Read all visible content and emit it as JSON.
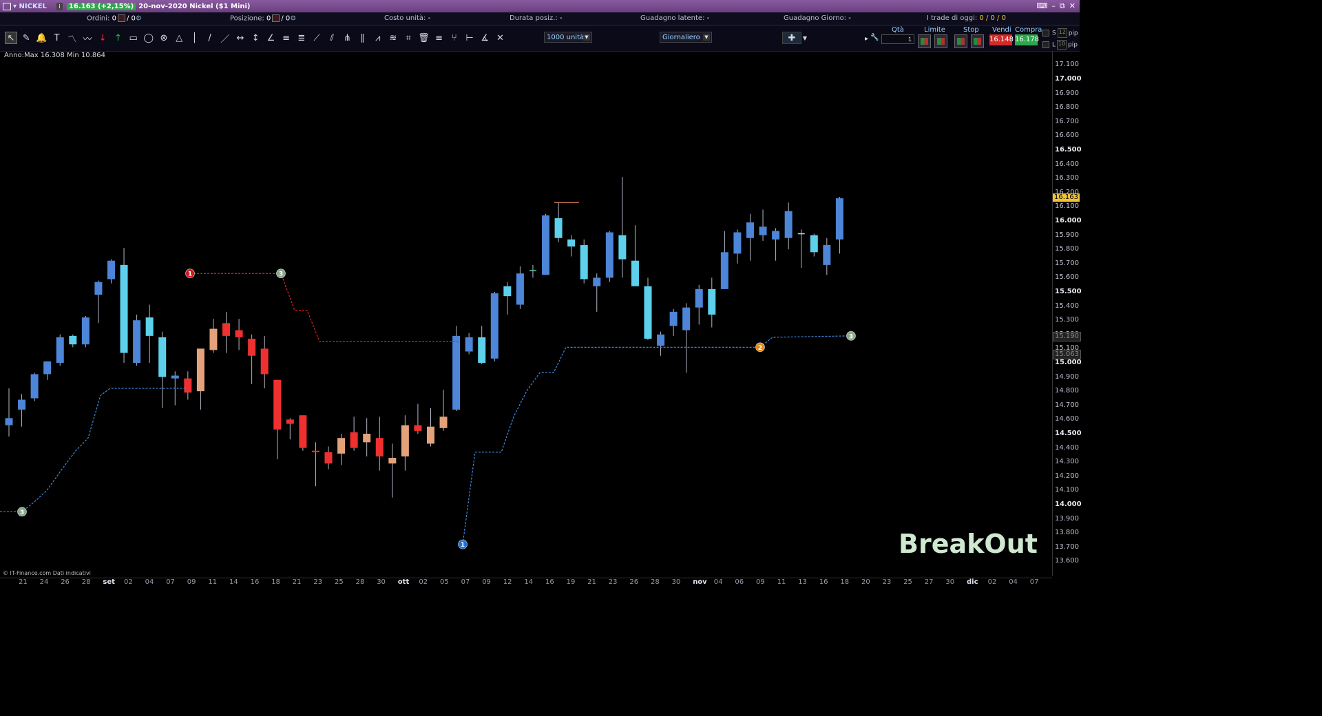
{
  "window": {
    "symbol": "NICKEL",
    "quote_badge": "16.163 (+2,15%)",
    "description": "20-nov-2020 Nickel ($1 Mini)"
  },
  "infobar": {
    "orders_label": "Ordini:",
    "orders_value": "0",
    "orders_sep": "/ 0",
    "position_label": "Posizione:",
    "position_value": "0",
    "position_sep": "/ 0",
    "unit_cost_label": "Costo unità:",
    "unit_cost_value": "-",
    "duration_label": "Durata posiz.:",
    "duration_value": "-",
    "latent_gain_label": "Guadagno latente:",
    "latent_gain_value": "-",
    "day_gain_label": "Guadagno Giorno:",
    "day_gain_value": "-",
    "trades_label": "I trade di oggi:",
    "trades_value": "0 / 0 / 0"
  },
  "toolbar": {
    "units_select": "1000 unità",
    "period_select": "Giornaliero",
    "tools": [
      "pointer-tool",
      "pencil-tool",
      "alert-bell-tool",
      "text-tool",
      "indicator-line-tool",
      "wave-tool",
      "sell-arrow-tool",
      "buy-arrow-tool",
      "rectangle-tool",
      "ellipse-tool",
      "circle-tool",
      "triangle-tool",
      "vertical-line-tool",
      "trend-line-tool",
      "ray-tool",
      "horizontal-segment-tool",
      "vertical-segment-tool",
      "angle-tool",
      "fibonacci-tool",
      "fibonacci-fan-tool",
      "gann-fan-tool",
      "speed-lines-tool",
      "andrews-tool",
      "parallel-channel-tool",
      "regression-tool",
      "raff-channel-tool",
      "gann-grid-tool",
      "trash-tool",
      "equidistant-channel-tool",
      "pitchfork-tool",
      "measure-tool",
      "gann-angle-tool",
      "cross-lines-tool"
    ]
  },
  "trade_panel": {
    "qty_label": "Qtà",
    "qty_value": "1",
    "limit_label": "Limite",
    "stop_label": "Stop",
    "sell_label": "Vendi",
    "sell_price": "16.148",
    "buy_label": "Compra",
    "buy_price": "16.178",
    "s_label": "S",
    "s_value": "12",
    "l_label": "L",
    "l_value": "10",
    "pip_label": "pip"
  },
  "range_label": "Anno:Max 16.308 Min 10.864",
  "copyright": "© IT-Finance.com Dati indicativi",
  "brand_text": "BreakOut",
  "colors": {
    "bull_dark": "#4d85d8",
    "bull_light": "#5dd0ec",
    "bear_red": "#ee3030",
    "bear_tan": "#e3a27a",
    "stop_blue": "#3d8be0",
    "stop_red": "#e02020",
    "current_price_bg": "#f2c230"
  },
  "chart_data": {
    "type": "candlestick",
    "y_ticks": [
      "17.100",
      "17.000",
      "16.900",
      "16.800",
      "16.700",
      "16.600",
      "16.500",
      "16.400",
      "16.300",
      "16.200",
      "16.100",
      "16.000",
      "15.900",
      "15.800",
      "15.700",
      "15.600",
      "15.500",
      "15.400",
      "15.300",
      "15.200",
      "15.100",
      "15.000",
      "14.900",
      "14.800",
      "14.700",
      "14.600",
      "14.500",
      "14.400",
      "14.300",
      "14.200",
      "14.100",
      "14.000",
      "13.900",
      "13.800",
      "13.700",
      "13.600"
    ],
    "y_major": [
      "17.000",
      "16.500",
      "16.000",
      "15.500",
      "15.000",
      "14.500",
      "14.000"
    ],
    "current_price": "16.163",
    "price_markers": [
      {
        "value": "15.190",
        "style": "line"
      },
      {
        "value": "15.063",
        "style": "line"
      }
    ],
    "x_labels": [
      "21",
      "24",
      "26",
      "28",
      "set",
      "02",
      "04",
      "07",
      "09",
      "11",
      "14",
      "16",
      "18",
      "21",
      "23",
      "25",
      "28",
      "30",
      "ott",
      "02",
      "05",
      "07",
      "09",
      "12",
      "14",
      "16",
      "19",
      "21",
      "23",
      "26",
      "28",
      "30",
      "nov",
      "04",
      "06",
      "09",
      "11",
      "13",
      "16",
      "18",
      "20",
      "23",
      "25",
      "27",
      "30",
      "dic",
      "02",
      "04",
      "07"
    ],
    "candles": [
      {
        "o": 14.56,
        "h": 14.82,
        "l": 14.48,
        "c": 14.61,
        "k": "bd"
      },
      {
        "o": 14.67,
        "h": 14.78,
        "l": 14.55,
        "c": 14.74,
        "k": "bd"
      },
      {
        "o": 14.75,
        "h": 14.93,
        "l": 14.73,
        "c": 14.92,
        "k": "bd"
      },
      {
        "o": 14.92,
        "h": 15.0,
        "l": 14.88,
        "c": 15.01,
        "k": "bd"
      },
      {
        "o": 15.0,
        "h": 15.2,
        "l": 14.98,
        "c": 15.18,
        "k": "bd"
      },
      {
        "o": 15.13,
        "h": 15.2,
        "l": 15.11,
        "c": 15.19,
        "k": "bl"
      },
      {
        "o": 15.13,
        "h": 15.33,
        "l": 15.11,
        "c": 15.32,
        "k": "bd"
      },
      {
        "o": 15.48,
        "h": 15.58,
        "l": 15.28,
        "c": 15.57,
        "k": "bd"
      },
      {
        "o": 15.59,
        "h": 15.73,
        "l": 15.56,
        "c": 15.72,
        "k": "bd"
      },
      {
        "o": 15.69,
        "h": 15.81,
        "l": 15.0,
        "c": 15.07,
        "k": "bl"
      },
      {
        "o": 15.0,
        "h": 15.34,
        "l": 14.98,
        "c": 15.3,
        "k": "bd"
      },
      {
        "o": 15.19,
        "h": 15.41,
        "l": 15.0,
        "c": 15.32,
        "k": "bl"
      },
      {
        "o": 15.18,
        "h": 15.22,
        "l": 14.68,
        "c": 14.9,
        "k": "bl"
      },
      {
        "o": 14.89,
        "h": 14.94,
        "l": 14.7,
        "c": 14.91,
        "k": "bd"
      },
      {
        "o": 14.89,
        "h": 14.94,
        "l": 14.74,
        "c": 14.79,
        "k": "rr"
      },
      {
        "o": 14.8,
        "h": 15.0,
        "l": 14.67,
        "c": 15.1,
        "k": "rt"
      },
      {
        "o": 15.09,
        "h": 15.31,
        "l": 15.07,
        "c": 15.24,
        "k": "rt"
      },
      {
        "o": 15.28,
        "h": 15.36,
        "l": 15.07,
        "c": 15.19,
        "k": "rr"
      },
      {
        "o": 15.23,
        "h": 15.31,
        "l": 15.09,
        "c": 15.18,
        "k": "rr"
      },
      {
        "o": 15.17,
        "h": 15.2,
        "l": 14.85,
        "c": 15.05,
        "k": "rr"
      },
      {
        "o": 15.1,
        "h": 15.19,
        "l": 14.82,
        "c": 14.92,
        "k": "rr"
      },
      {
        "o": 14.88,
        "h": 14.88,
        "l": 14.32,
        "c": 14.53,
        "k": "rr"
      },
      {
        "o": 14.6,
        "h": 14.61,
        "l": 14.46,
        "c": 14.57,
        "k": "rr"
      },
      {
        "o": 14.63,
        "h": 14.63,
        "l": 14.38,
        "c": 14.4,
        "k": "rr"
      },
      {
        "o": 14.37,
        "h": 14.44,
        "l": 14.13,
        "c": 14.38,
        "k": "rr"
      },
      {
        "o": 14.37,
        "h": 14.41,
        "l": 14.25,
        "c": 14.29,
        "k": "rr"
      },
      {
        "o": 14.36,
        "h": 14.5,
        "l": 14.28,
        "c": 14.47,
        "k": "rt"
      },
      {
        "o": 14.51,
        "h": 14.62,
        "l": 14.38,
        "c": 14.4,
        "k": "rr"
      },
      {
        "o": 14.44,
        "h": 14.61,
        "l": 14.34,
        "c": 14.5,
        "k": "rt"
      },
      {
        "o": 14.47,
        "h": 14.62,
        "l": 14.24,
        "c": 14.34,
        "k": "rr"
      },
      {
        "o": 14.29,
        "h": 14.43,
        "l": 14.05,
        "c": 14.33,
        "k": "rt"
      },
      {
        "o": 14.34,
        "h": 14.63,
        "l": 14.24,
        "c": 14.56,
        "k": "rt"
      },
      {
        "o": 14.56,
        "h": 14.71,
        "l": 14.5,
        "c": 14.52,
        "k": "rr"
      },
      {
        "o": 14.43,
        "h": 14.68,
        "l": 14.41,
        "c": 14.55,
        "k": "rt"
      },
      {
        "o": 14.54,
        "h": 14.81,
        "l": 14.52,
        "c": 14.62,
        "k": "rt"
      },
      {
        "o": 14.67,
        "h": 15.26,
        "l": 14.66,
        "c": 15.19,
        "k": "bd"
      },
      {
        "o": 15.08,
        "h": 15.21,
        "l": 15.06,
        "c": 15.18,
        "k": "bd"
      },
      {
        "o": 15.0,
        "h": 15.26,
        "l": 14.99,
        "c": 15.18,
        "k": "bl"
      },
      {
        "o": 15.03,
        "h": 15.5,
        "l": 15.01,
        "c": 15.49,
        "k": "bd"
      },
      {
        "o": 15.47,
        "h": 15.57,
        "l": 15.34,
        "c": 15.54,
        "k": "bl"
      },
      {
        "o": 15.41,
        "h": 15.68,
        "l": 15.38,
        "c": 15.63,
        "k": "bd"
      },
      {
        "o": 15.64,
        "h": 15.69,
        "l": 15.6,
        "c": 15.65,
        "k": "cross"
      },
      {
        "o": 15.62,
        "h": 16.05,
        "l": 15.62,
        "c": 16.04,
        "k": "bd"
      },
      {
        "o": 16.02,
        "h": 16.13,
        "l": 15.85,
        "c": 15.88,
        "k": "bl"
      },
      {
        "o": 15.87,
        "h": 15.9,
        "l": 15.75,
        "c": 15.82,
        "k": "bl"
      },
      {
        "o": 15.83,
        "h": 15.87,
        "l": 15.56,
        "c": 15.59,
        "k": "bl"
      },
      {
        "o": 15.54,
        "h": 15.63,
        "l": 15.36,
        "c": 15.6,
        "k": "bd"
      },
      {
        "o": 15.6,
        "h": 15.93,
        "l": 15.57,
        "c": 15.92,
        "k": "bd"
      },
      {
        "o": 15.9,
        "h": 16.31,
        "l": 15.6,
        "c": 15.73,
        "k": "bl"
      },
      {
        "o": 15.72,
        "h": 15.97,
        "l": 15.55,
        "c": 15.54,
        "k": "bl"
      },
      {
        "o": 15.54,
        "h": 15.6,
        "l": 15.16,
        "c": 15.17,
        "k": "bl"
      },
      {
        "o": 15.12,
        "h": 15.22,
        "l": 15.05,
        "c": 15.2,
        "k": "bd"
      },
      {
        "o": 15.26,
        "h": 15.38,
        "l": 15.19,
        "c": 15.36,
        "k": "bd"
      },
      {
        "o": 15.23,
        "h": 15.42,
        "l": 14.93,
        "c": 15.39,
        "k": "bd"
      },
      {
        "o": 15.39,
        "h": 15.55,
        "l": 15.27,
        "c": 15.52,
        "k": "bd"
      },
      {
        "o": 15.34,
        "h": 15.6,
        "l": 15.25,
        "c": 15.52,
        "k": "bl"
      },
      {
        "o": 15.52,
        "h": 15.93,
        "l": 15.52,
        "c": 15.78,
        "k": "bd"
      },
      {
        "o": 15.77,
        "h": 15.94,
        "l": 15.7,
        "c": 15.92,
        "k": "bd"
      },
      {
        "o": 15.88,
        "h": 16.05,
        "l": 15.72,
        "c": 15.99,
        "k": "bd"
      },
      {
        "o": 15.9,
        "h": 16.08,
        "l": 15.86,
        "c": 15.96,
        "k": "bd"
      },
      {
        "o": 15.87,
        "h": 15.95,
        "l": 15.72,
        "c": 15.93,
        "k": "bd"
      },
      {
        "o": 15.88,
        "h": 16.13,
        "l": 15.8,
        "c": 16.07,
        "k": "bd"
      },
      {
        "o": 15.91,
        "h": 15.94,
        "l": 15.67,
        "c": 15.91,
        "k": "cross2"
      },
      {
        "o": 15.78,
        "h": 15.91,
        "l": 15.75,
        "c": 15.9,
        "k": "bl"
      },
      {
        "o": 15.69,
        "h": 15.88,
        "l": 15.62,
        "c": 15.83,
        "k": "bd"
      },
      {
        "o": 15.87,
        "h": 16.17,
        "l": 15.77,
        "c": 16.16,
        "k": "bd"
      }
    ]
  }
}
